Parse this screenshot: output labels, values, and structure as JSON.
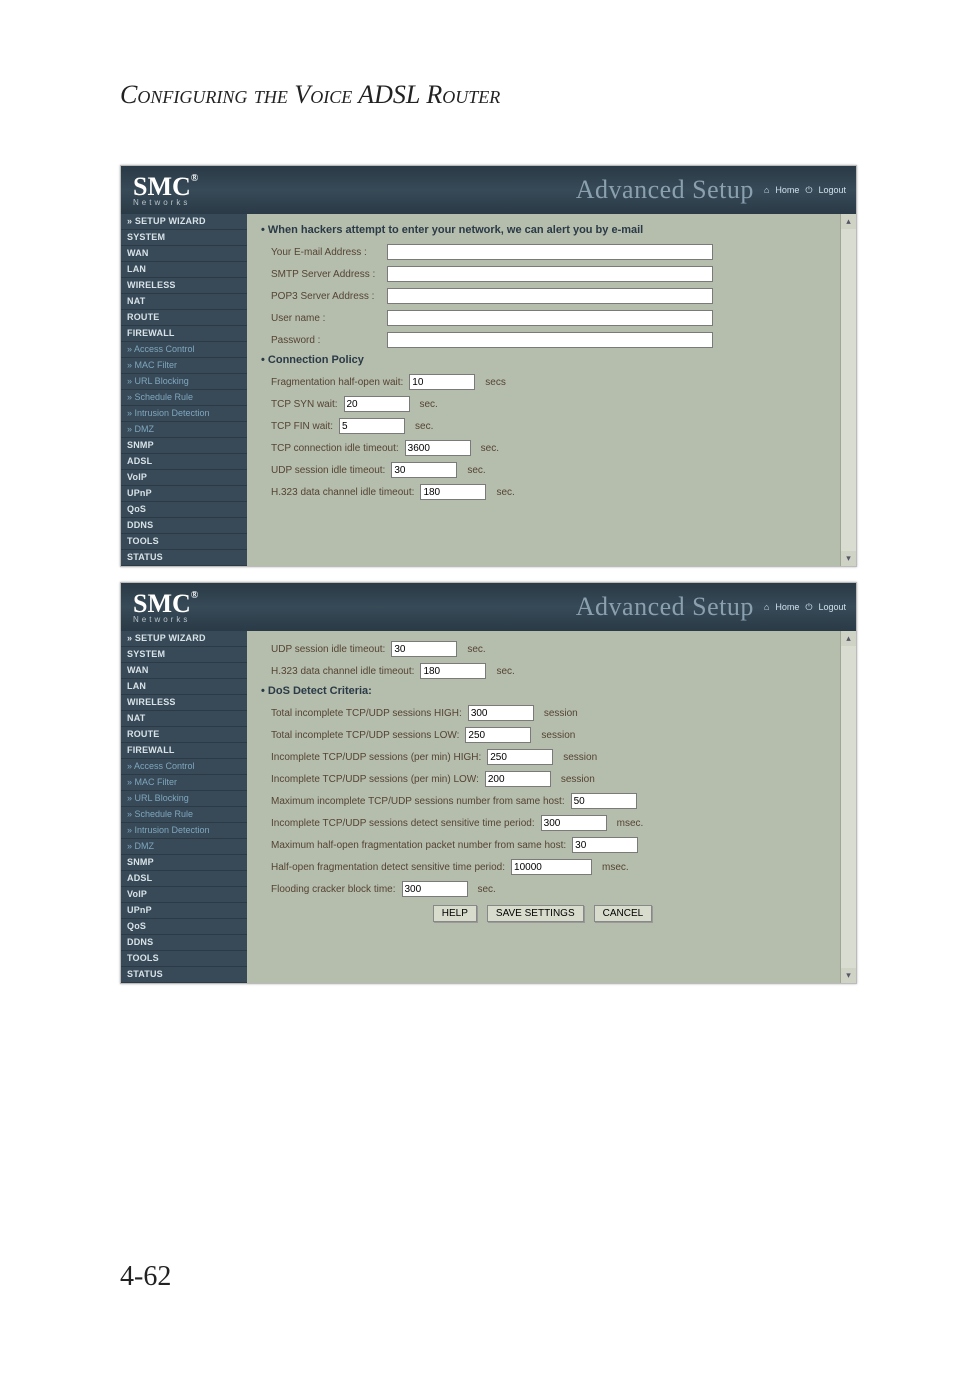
{
  "doc_title": "Configuring the Voice ADSL Router",
  "page_number": "4-62",
  "brand": "SMC",
  "brand_sub": "Networks",
  "advanced_label": "Advanced Setup",
  "top_links": {
    "home": "Home",
    "logout": "Logout"
  },
  "sidebar": {
    "setup_wizard": "» SETUP WIZARD",
    "items": [
      "SYSTEM",
      "WAN",
      "LAN",
      "WIRELESS",
      "NAT",
      "ROUTE",
      "FIREWALL"
    ],
    "firewall_sub": [
      "Access Control",
      "MAC Filter",
      "URL Blocking",
      "Schedule Rule",
      "Intrusion Detection",
      "DMZ"
    ],
    "items2": [
      "SNMP",
      "ADSL",
      "VoIP",
      "UPnP",
      "QoS",
      "DDNS",
      "TOOLS",
      "STATUS"
    ]
  },
  "panel1": {
    "section_alert": "When hackers attempt to enter your network, we can alert you by e-mail",
    "labels": {
      "email": "Your E-mail Address :",
      "smtp": "SMTP Server Address :",
      "pop3": "POP3 Server Address :",
      "user": "User name :",
      "pass": "Password :"
    },
    "section_conn": "Connection Policy",
    "conn": {
      "frag_label": "Fragmentation half-open wait:",
      "frag_value": "10",
      "frag_unit": "secs",
      "syn_label": "TCP SYN wait:",
      "syn_value": "20",
      "syn_unit": "sec.",
      "fin_label": "TCP FIN wait:",
      "fin_value": "5",
      "fin_unit": "sec.",
      "idle_label": "TCP connection idle timeout:",
      "idle_value": "3600",
      "idle_unit": "sec.",
      "udp_label": "UDP session idle timeout:",
      "udp_value": "30",
      "udp_unit": "sec.",
      "h323_label": "H.323 data channel idle timeout:",
      "h323_value": "180",
      "h323_unit": "sec."
    }
  },
  "panel2": {
    "top": {
      "udp_label": "UDP session idle timeout:",
      "udp_value": "30",
      "udp_unit": "sec.",
      "h323_label": "H.323 data channel idle timeout:",
      "h323_value": "180",
      "h323_unit": "sec."
    },
    "section_dos": "DoS Detect Criteria:",
    "dos": {
      "inc_high_label": "Total incomplete TCP/UDP sessions HIGH:",
      "inc_high_value": "300",
      "sess": "session",
      "inc_low_label": "Total incomplete TCP/UDP sessions LOW:",
      "inc_low_value": "250",
      "pm_high_label": "Incomplete TCP/UDP sessions (per min) HIGH:",
      "pm_high_value": "250",
      "pm_low_label": "Incomplete TCP/UDP sessions (per min) LOW:",
      "pm_low_value": "200",
      "max_same_label": "Maximum incomplete TCP/UDP sessions number from same host:",
      "max_same_value": "50",
      "detect_period_label": "Incomplete TCP/UDP sessions detect sensitive time period:",
      "detect_period_value": "300",
      "msec": "msec.",
      "max_frag_label": "Maximum half-open fragmentation packet number from same host:",
      "max_frag_value": "30",
      "frag_period_label": "Half-open fragmentation detect sensitive time period:",
      "frag_period_value": "10000",
      "flood_label": "Flooding cracker block time:",
      "flood_value": "300",
      "sec": "sec."
    },
    "buttons": {
      "help": "HELP",
      "save": "SAVE SETTINGS",
      "cancel": "CANCEL"
    }
  }
}
